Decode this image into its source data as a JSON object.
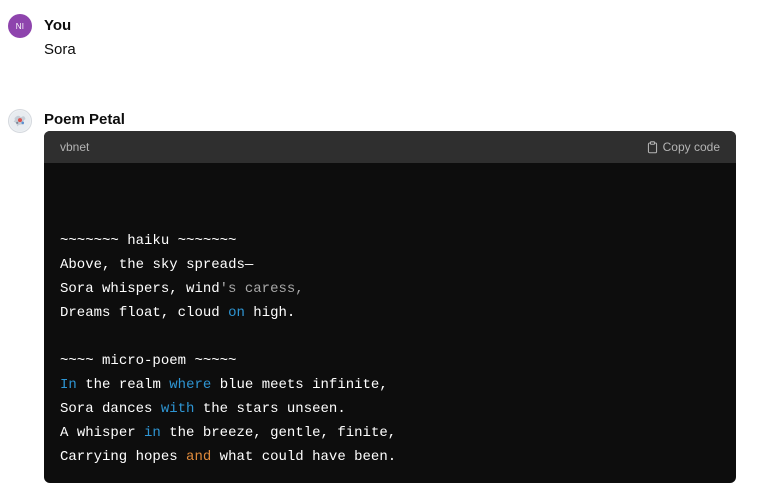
{
  "user_message": {
    "avatar_initials": "NI",
    "author": "You",
    "text": "Sora"
  },
  "bot_message": {
    "author": "Poem Petal",
    "code_language": "vbnet",
    "copy_label": "Copy code",
    "code_lines": [
      "",
      "~~~~~~~ haiku ~~~~~~~",
      "Above, the sky spreads—",
      "Sora whispers, wind's caress,",
      "Dreams float, cloud on high.",
      "",
      "~~~~ micro-poem ~~~~~",
      "In the realm where blue meets infinite,",
      "Sora dances with the stars unseen.",
      "A whisper in the breeze, gentle, finite,",
      "Carrying hopes and what could have been."
    ]
  },
  "colors": {
    "keyword": "#2e95d3",
    "string": "#a8a8a8",
    "operator": "#df8a3b",
    "code_bg": "#0d0d0d",
    "code_header_bg": "#2f2f2f",
    "user_avatar": "#8e44ad"
  },
  "icons": [
    "clipboard-icon",
    "bot-avatar"
  ]
}
